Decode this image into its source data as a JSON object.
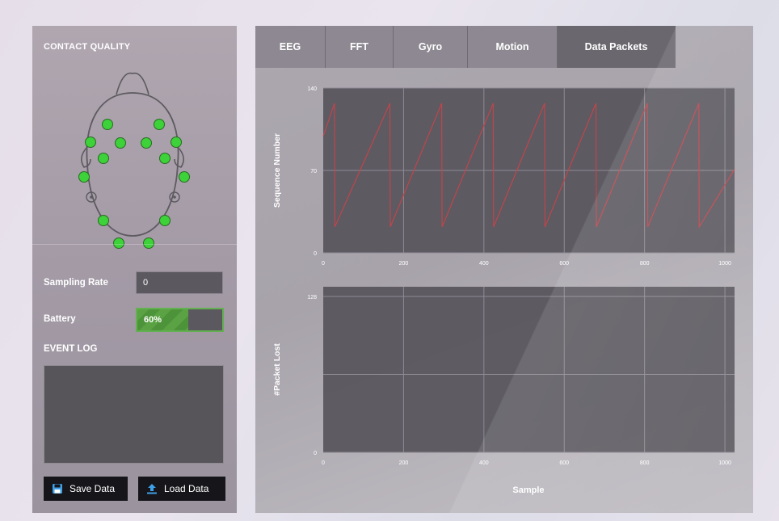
{
  "left": {
    "contact_quality_title": "CONTACT QUALITY",
    "sampling_rate_label": "Sampling Rate",
    "sampling_rate_value": "0",
    "battery_label": "Battery",
    "battery_value": "60%",
    "battery_level": 0.6,
    "event_log_label": "EVENT LOG",
    "save_label": "Save Data",
    "load_label": "Load Data",
    "sensor_color": "#3dd13a"
  },
  "tabs": [
    {
      "label": "EEG",
      "active": false
    },
    {
      "label": "FFT",
      "active": false
    },
    {
      "label": "Gyro",
      "active": false
    },
    {
      "label": "Motion",
      "active": false
    },
    {
      "label": "Data Packets",
      "active": true
    }
  ],
  "chart_data": [
    {
      "type": "line",
      "title": "",
      "xlabel": "",
      "ylabel": "Sequence Number",
      "xlim": [
        0,
        1024
      ],
      "ylim": [
        0,
        140
      ],
      "xticks": [
        0,
        200,
        400,
        600,
        800,
        1000
      ],
      "yticks": [
        0,
        70,
        140
      ],
      "grid": true,
      "series": [
        {
          "color": "#c0454b",
          "x": [
            0,
            28,
            29,
            166,
            167,
            295,
            296,
            423,
            424,
            551,
            552,
            679,
            680,
            807,
            808,
            935,
            936,
            1024
          ],
          "y": [
            99,
            127,
            22,
            127,
            22,
            127,
            22,
            127,
            22,
            127,
            22,
            127,
            22,
            127,
            22,
            127,
            22,
            71
          ]
        }
      ]
    },
    {
      "type": "line",
      "title": "",
      "xlabel": "Sample",
      "ylabel": "#Packet Lost",
      "xlim": [
        0,
        1024
      ],
      "ylim": [
        0,
        136
      ],
      "xticks": [
        0,
        200,
        400,
        600,
        800,
        1000
      ],
      "yticks": [
        0,
        128
      ],
      "grid": true,
      "series": []
    }
  ]
}
